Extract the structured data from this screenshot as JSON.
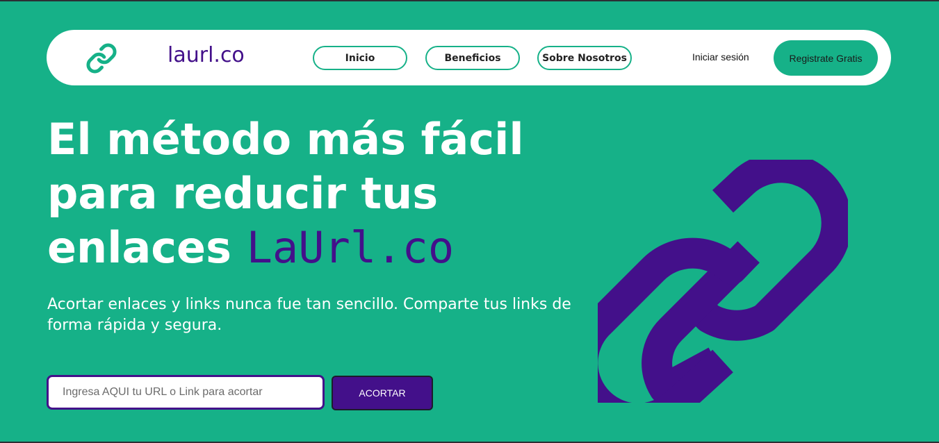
{
  "header": {
    "brand": "laurl.co",
    "nav": {
      "inicio": "Inicio",
      "beneficios": "Beneficios",
      "sobre": "Sobre Nosotros"
    },
    "login": "Iniciar sesión",
    "register": "Registrate Gratis"
  },
  "hero": {
    "title_line1": "El método más fácil",
    "title_line2": "para reducir tus",
    "title_line3_prefix": "enlaces ",
    "title_accent": "LaUrl.co",
    "subtitle": "Acortar enlaces y links nunca fue tan sencillo. Comparte tus links de forma rápida y segura."
  },
  "shortener": {
    "placeholder": "Ingresa AQUI tu URL o Link para acortar",
    "value": "",
    "button": "ACORTAR"
  },
  "icons": {
    "logo": "link-chain-icon",
    "hero": "link-chain-icon"
  },
  "colors": {
    "background": "#16b188",
    "accent": "#43108a",
    "navbar": "#ffffff"
  }
}
